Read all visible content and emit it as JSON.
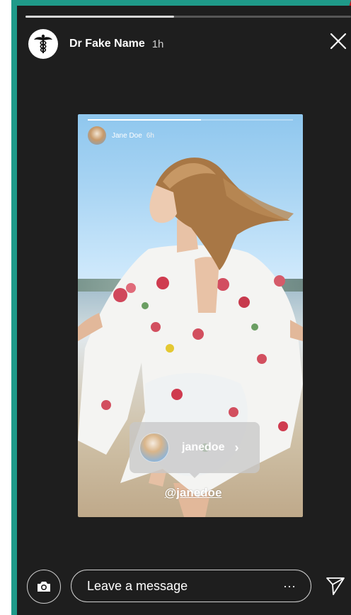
{
  "story": {
    "author_name": "Dr Fake Name",
    "time_ago": "1h",
    "icons": {
      "avatar": "caduceus-icon",
      "close": "close-icon"
    }
  },
  "shared_post": {
    "author_name": "Jane Doe",
    "time_ago": "6h",
    "mention_chip": {
      "username": "janedoe",
      "arrow_icon": "chevron-right-icon"
    },
    "mention_text": "@janedoe"
  },
  "bottom_bar": {
    "message_placeholder": "Leave a message",
    "more_label": "···",
    "icons": {
      "camera": "camera-icon",
      "send": "send-icon"
    }
  },
  "colors": {
    "frame_border": "#1f9a89",
    "screen_bg": "#1e1e1e",
    "accent_red": "#c0151c"
  }
}
